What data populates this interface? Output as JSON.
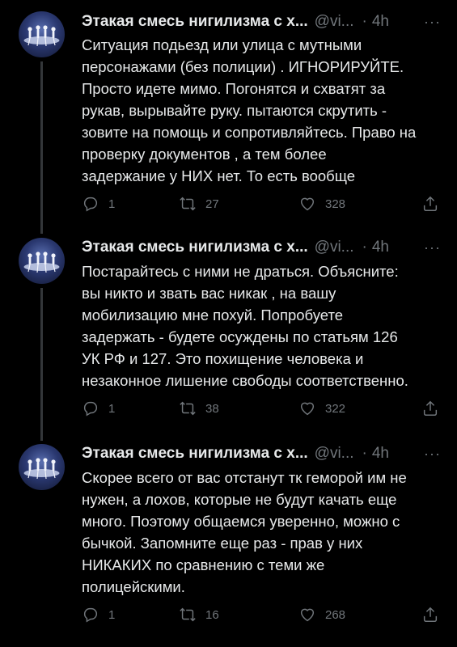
{
  "tweets": [
    {
      "author": "Этакая смесь нигилизма с х...",
      "handle": "@vi...",
      "dot": "·",
      "time": "4h",
      "more": "···",
      "lines": [
        "Ситуация подьезд или улица с мутными",
        "персонажами (без полиции) . ИГНОРИРУЙТЕ.",
        "Просто идете мимо. Погонятся и схватят за",
        "рукав, вырывайте руку. пытаются скрутить -",
        "зовите на помощь и сопротивляйтесь. Право на",
        "проверку документов , а тем более",
        "задержание у НИХ нет. То есть вообще"
      ],
      "replies": "1",
      "retweets": "27",
      "likes": "328"
    },
    {
      "author": "Этакая смесь нигилизма с х...",
      "handle": "@vi...",
      "dot": "·",
      "time": "4h",
      "more": "···",
      "lines": [
        "Постарайтесь с ними не драться. Объясните:",
        "вы никто и звать вас никак , на вашу",
        "мобилизацию мне похуй. Попробуете",
        "задержать - будете осуждены по статьям 126",
        "УК РФ и 127. Это похищение человека и",
        "незаконное лишение свободы соответственно."
      ],
      "replies": "1",
      "retweets": "38",
      "likes": "322"
    },
    {
      "author": "Этакая смесь нигилизма с х...",
      "handle": "@vi...",
      "dot": "·",
      "time": "4h",
      "more": "···",
      "lines": [
        "Скорее всего от вас отстанут тк геморой им не",
        "нужен, а лохов, которые не будут качать еще",
        "много. Поэтому общаемся уверенно, можно с",
        "бычкой. Запомните еще раз - прав у них",
        "НИКАКИХ по сравнению с теми же",
        "полицейскими."
      ],
      "replies": "1",
      "retweets": "16",
      "likes": "268"
    }
  ],
  "icons": {
    "reply": "reply-icon",
    "retweet": "retweet-icon",
    "like": "heart-icon",
    "share": "share-icon",
    "more": "more-icon"
  }
}
